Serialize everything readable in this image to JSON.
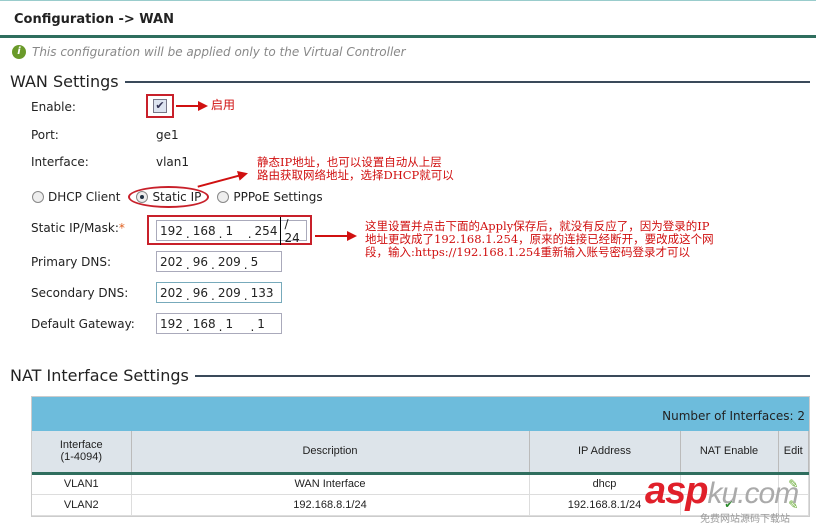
{
  "title": "Configuration -> WAN",
  "info": "This configuration will be applied only to the Virtual Controller",
  "wan": {
    "heading": "WAN Settings",
    "enable_label": "Enable:",
    "enable_checked": true,
    "port_label": "Port:",
    "port": "ge1",
    "interface_label": "Interface:",
    "interface": "vlan1",
    "modes": [
      "DHCP Client",
      "Static IP",
      "PPPoE Settings"
    ],
    "selected_mode": "Static IP",
    "ip_label": "Static IP/Mask:",
    "required_mark": "*",
    "ip": [
      "192",
      "168",
      "1",
      "254"
    ],
    "mask": "/ 24",
    "dns1_label": "Primary DNS:",
    "dns1": [
      "202",
      "96",
      "209",
      "5"
    ],
    "dns2_label": "Secondary DNS:",
    "dns2": [
      "202",
      "96",
      "209",
      "133"
    ],
    "gw_label": "Default Gateway:",
    "gw": [
      "192",
      "168",
      "1",
      "1"
    ]
  },
  "notes": {
    "enable": "启用",
    "static": [
      "静态IP地址，也可以设置自动从上层",
      "路由获取网络地址，选择DHCP就可以"
    ],
    "ip": [
      "这里设置并点击下面的Apply保存后，就没有反应了，因为登录的IP",
      "地址更改成了192.168.1.254，原来的连接已经断开，要改成这个网",
      "段，输入:https://192.168.1.254重新输入账号密码登录才可以"
    ]
  },
  "nat": {
    "heading": "NAT Interface Settings",
    "count_label": "Number of Interfaces:",
    "count": "2",
    "columns": [
      "Interface",
      "(1-4094)",
      "Description",
      "IP Address",
      "NAT Enable",
      "Edit"
    ],
    "rows": [
      {
        "iface": "VLAN1",
        "desc": "WAN Interface",
        "ip": "dhcp"
      },
      {
        "iface": "VLAN2",
        "desc": "192.168.8.1/24",
        "ip": "192.168.8.1/24"
      }
    ]
  },
  "watermark": {
    "brand": "asp",
    "brand2": "ku.com",
    "sub": "免费网站源码下载站"
  },
  "colors": {
    "accent": "#2f6e5e",
    "table_header": "#6dbcdc",
    "annotation": "#d01010"
  }
}
